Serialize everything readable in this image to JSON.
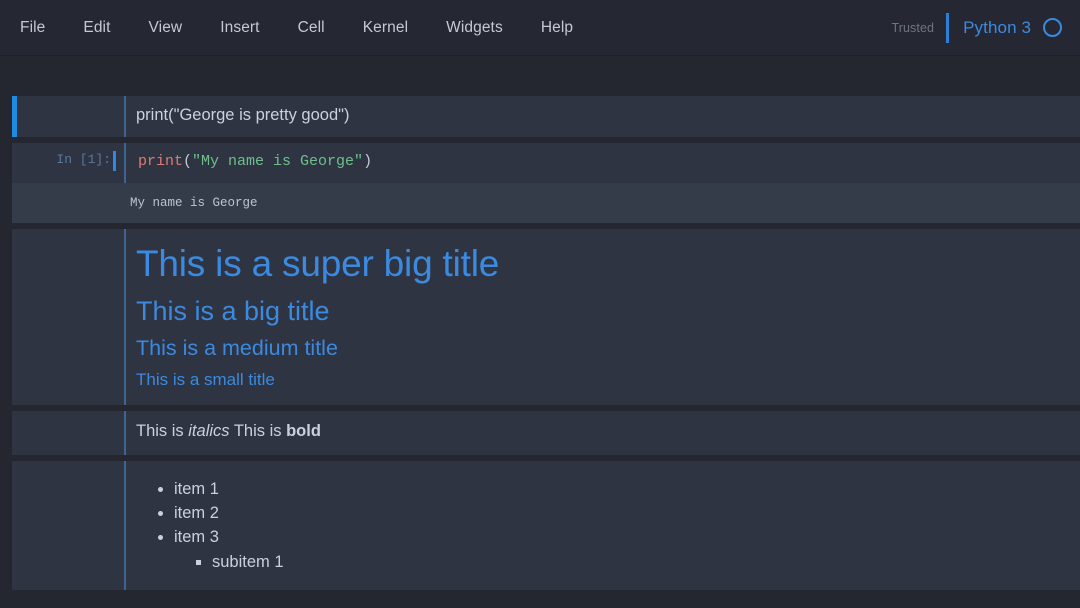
{
  "menubar": {
    "items": [
      {
        "label": "File"
      },
      {
        "label": "Edit"
      },
      {
        "label": "View"
      },
      {
        "label": "Insert"
      },
      {
        "label": "Cell"
      },
      {
        "label": "Kernel"
      },
      {
        "label": "Widgets"
      },
      {
        "label": "Help"
      }
    ],
    "trusted_label": "Trusted",
    "kernel_name": "Python 3",
    "kernel_status_icon": "circle-outline-idle-icon",
    "accent_color": "#3b8ae0",
    "selection_bar_color": "#1f8ce0"
  },
  "notebook": {
    "cells": [
      {
        "type": "markdown-unrendered",
        "selected": true,
        "prompt": "",
        "text": "print(\"George is pretty good\")"
      },
      {
        "type": "code",
        "selected": false,
        "prompt": "In [1]:",
        "code_tokens": [
          {
            "text": "print",
            "kind": "function"
          },
          {
            "text": "(",
            "kind": "punctuation"
          },
          {
            "text": "\"My name is George\"",
            "kind": "string"
          },
          {
            "text": ")",
            "kind": "punctuation"
          }
        ],
        "output": "My name is George"
      },
      {
        "type": "markdown-headings",
        "selected": false,
        "prompt": "",
        "headings": [
          {
            "level": 1,
            "text": "This is a super big title"
          },
          {
            "level": 2,
            "text": "This is a big title"
          },
          {
            "level": 3,
            "text": "This is a medium title"
          },
          {
            "level": 4,
            "text": "This is a small title"
          }
        ]
      },
      {
        "type": "markdown-richtext",
        "selected": false,
        "prompt": "",
        "segments": [
          {
            "text": "This is ",
            "style": "normal"
          },
          {
            "text": "italics",
            "style": "italic"
          },
          {
            "text": " This is ",
            "style": "normal"
          },
          {
            "text": "bold",
            "style": "bold"
          }
        ]
      },
      {
        "type": "markdown-list",
        "selected": false,
        "prompt": "",
        "items": [
          {
            "text": "item 1"
          },
          {
            "text": "item 2"
          },
          {
            "text": "item 3"
          }
        ],
        "subitems": [
          {
            "text": "subitem 1"
          }
        ]
      }
    ]
  },
  "colors": {
    "page_background": "#242730",
    "menubar_background": "#252833",
    "cell_background": "#2f3442",
    "output_background": "#343c4a",
    "heading_blue": "#3b8ae0",
    "code_function": "#e07a73",
    "code_string": "#6fbf8b",
    "prompt_blue": "#59789c"
  }
}
